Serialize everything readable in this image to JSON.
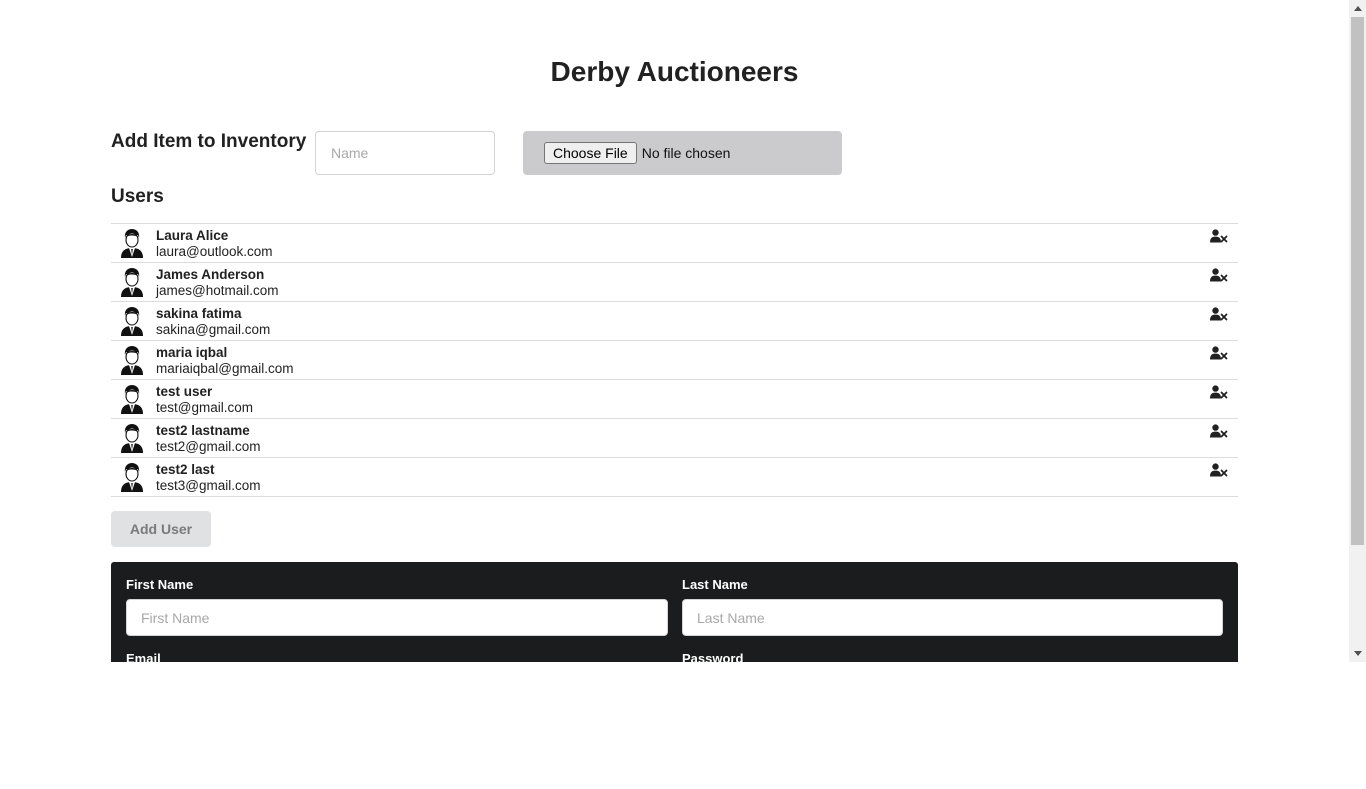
{
  "page": {
    "title": "Derby Auctioneers"
  },
  "inventory": {
    "heading": "Add Item to Inventory",
    "name_placeholder": "Name",
    "file_button_label": "Choose File",
    "file_status": "No file chosen"
  },
  "users": {
    "heading": "Users",
    "items": [
      {
        "name": "Laura Alice",
        "email": "laura@outlook.com",
        "avatar_icon": "user-avatar-icon",
        "action_icon": "user-times-icon"
      },
      {
        "name": "James Anderson",
        "email": "james@hotmail.com",
        "avatar_icon": "user-avatar-icon",
        "action_icon": "user-times-icon"
      },
      {
        "name": "sakina fatima",
        "email": "sakina@gmail.com",
        "avatar_icon": "user-avatar-icon",
        "action_icon": "user-times-icon"
      },
      {
        "name": "maria iqbal",
        "email": "mariaiqbal@gmail.com",
        "avatar_icon": "user-avatar-icon",
        "action_icon": "user-times-icon"
      },
      {
        "name": "test user",
        "email": "test@gmail.com",
        "avatar_icon": "user-avatar-icon",
        "action_icon": "user-times-icon"
      },
      {
        "name": "test2 lastname",
        "email": "test2@gmail.com",
        "avatar_icon": "user-avatar-icon",
        "action_icon": "user-times-icon"
      },
      {
        "name": "test2 last",
        "email": "test3@gmail.com",
        "avatar_icon": "user-avatar-icon",
        "action_icon": "user-times-icon"
      }
    ],
    "add_button_label": "Add User"
  },
  "user_form": {
    "first_name_label": "First Name",
    "first_name_placeholder": "First Name",
    "last_name_label": "Last Name",
    "last_name_placeholder": "Last Name",
    "email_label": "Email",
    "password_label": "Password"
  },
  "colors": {
    "form_background": "#1b1c1d",
    "file_box_background": "#cbcbcd",
    "button_background": "#e0e1e2"
  }
}
